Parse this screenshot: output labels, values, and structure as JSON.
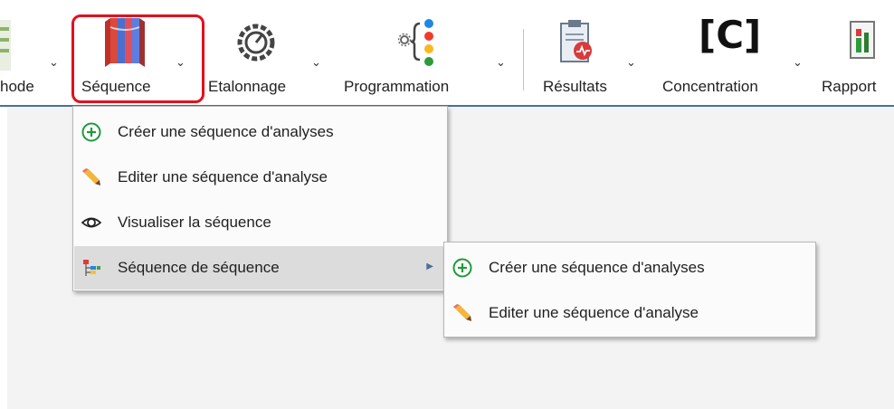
{
  "ribbon": {
    "items": [
      {
        "label": "hode",
        "icon": "method-icon"
      },
      {
        "label": "Séquence",
        "icon": "sequence-icon"
      },
      {
        "label": "Etalonnage",
        "icon": "gauge-icon"
      },
      {
        "label": "Programmation",
        "icon": "programming-icon"
      },
      {
        "label": "Résultats",
        "icon": "results-icon"
      },
      {
        "label": "Concentration",
        "icon": "concentration-icon",
        "glyph": "[C]"
      },
      {
        "label": "Rapport",
        "icon": "report-icon"
      }
    ],
    "highlight_color": "#e3101e",
    "accent": "#4a6f9a"
  },
  "menu": {
    "items": [
      {
        "label": "Créer une séquence d'analyses",
        "icon": "add-circle-icon"
      },
      {
        "label": "Editer une séquence d'analyse",
        "icon": "pencil-icon"
      },
      {
        "label": "Visualiser la séquence",
        "icon": "eye-icon"
      },
      {
        "label": "Séquence de séquence",
        "icon": "tree-icon",
        "has_submenu": true
      }
    ]
  },
  "submenu": {
    "items": [
      {
        "label": "Créer une séquence d'analyses",
        "icon": "add-circle-icon"
      },
      {
        "label": "Editer une séquence d'analyse",
        "icon": "pencil-icon"
      }
    ]
  }
}
